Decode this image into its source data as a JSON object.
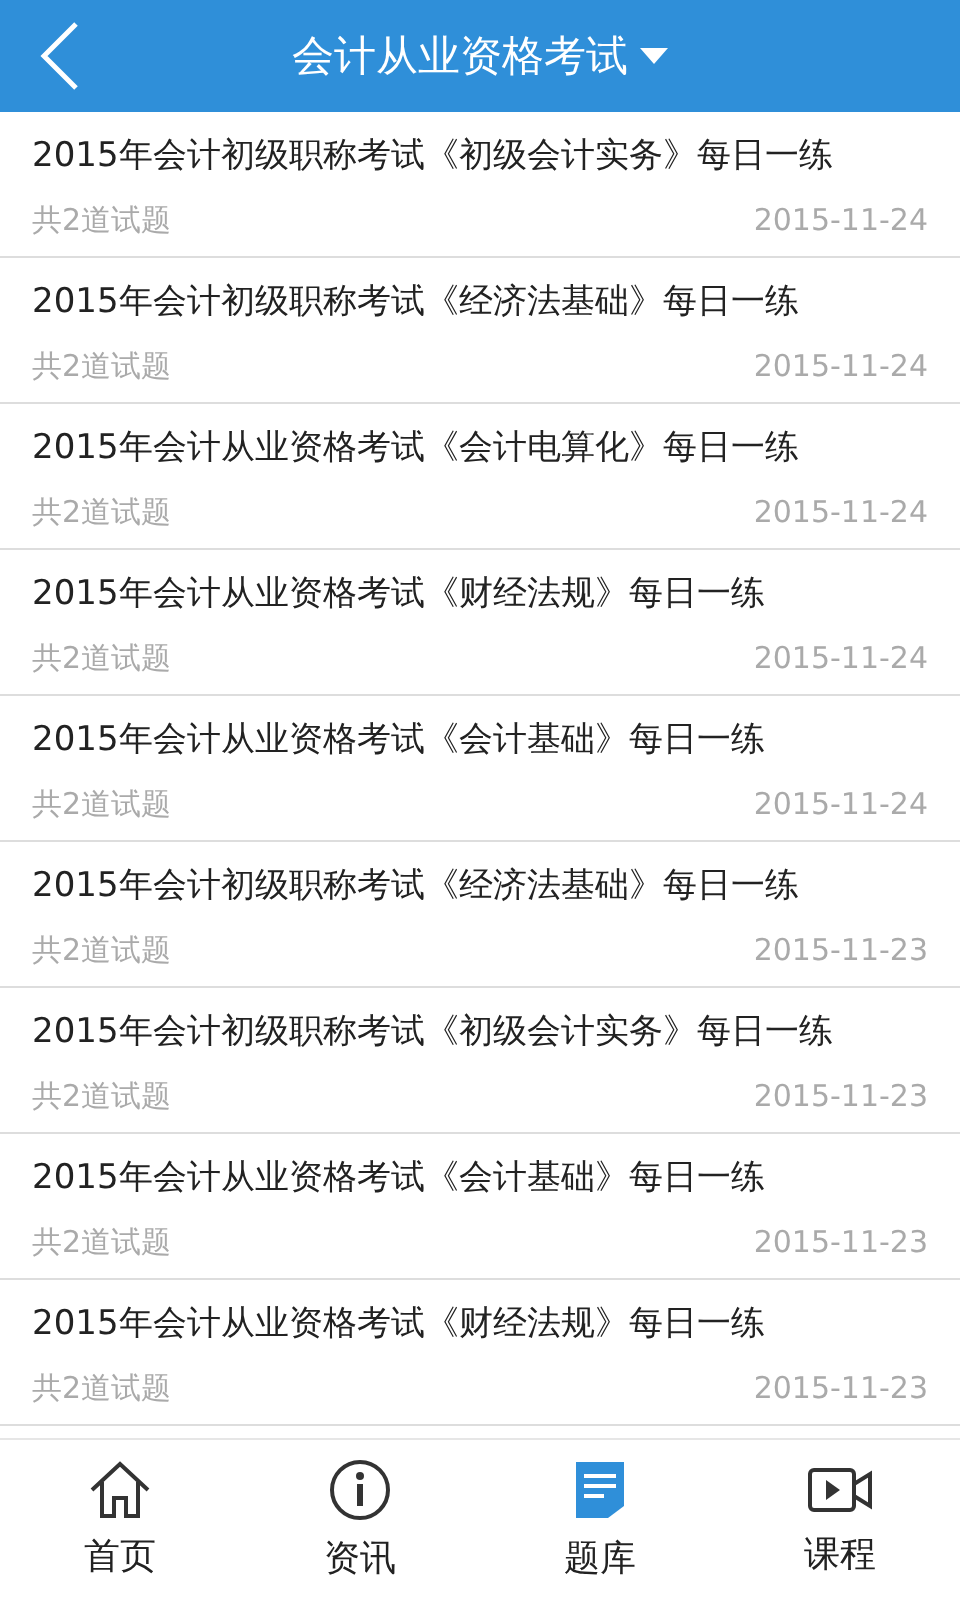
{
  "header": {
    "title": "会计从业资格考试"
  },
  "items": [
    {
      "title": "2015年会计初级职称考试《初级会计实务》每日一练",
      "count": "共2道试题",
      "date": "2015-11-24"
    },
    {
      "title": "2015年会计初级职称考试《经济法基础》每日一练",
      "count": "共2道试题",
      "date": "2015-11-24"
    },
    {
      "title": "2015年会计从业资格考试《会计电算化》每日一练",
      "count": "共2道试题",
      "date": "2015-11-24"
    },
    {
      "title": "2015年会计从业资格考试《财经法规》每日一练",
      "count": "共2道试题",
      "date": "2015-11-24"
    },
    {
      "title": "2015年会计从业资格考试《会计基础》每日一练",
      "count": "共2道试题",
      "date": "2015-11-24"
    },
    {
      "title": "2015年会计初级职称考试《经济法基础》每日一练",
      "count": "共2道试题",
      "date": "2015-11-23"
    },
    {
      "title": "2015年会计初级职称考试《初级会计实务》每日一练",
      "count": "共2道试题",
      "date": "2015-11-23"
    },
    {
      "title": "2015年会计从业资格考试《会计基础》每日一练",
      "count": "共2道试题",
      "date": "2015-11-23"
    },
    {
      "title": "2015年会计从业资格考试《财经法规》每日一练",
      "count": "共2道试题",
      "date": "2015-11-23"
    }
  ],
  "tabs": [
    {
      "kind": "home",
      "label": "首页",
      "selected": false
    },
    {
      "kind": "info",
      "label": "资讯",
      "selected": false
    },
    {
      "kind": "bank",
      "label": "题库",
      "selected": true
    },
    {
      "kind": "course",
      "label": "课程",
      "selected": false
    }
  ]
}
